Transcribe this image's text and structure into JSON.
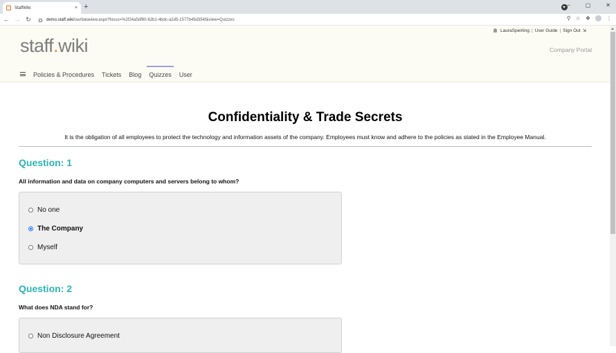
{
  "browser": {
    "tab_title": "StaffWiki",
    "tab_close": "×",
    "new_tab": "+",
    "window_controls": [
      "–",
      "▢",
      "✕"
    ],
    "url_host": "demo.staff.wiki",
    "url_path": "/sw/dataview.aspx?focus=%2f24a5df80-62b1-4bdc-a2d5-1577b45d354f&view=Quizzes"
  },
  "site": {
    "logo_main": "staff",
    "logo_dot": ".",
    "logo_suffix": "wiki",
    "portal_label": "Company Portal",
    "user_name": "LauraSpeirling",
    "user_guide": "User Guide",
    "sign_out": "Sign Out",
    "nav": [
      "Policies & Procedures",
      "Tickets",
      "Blog",
      "Quizzes",
      "User"
    ],
    "active_nav": "Quizzes"
  },
  "quiz": {
    "title": "Confidentiality & Trade Secrets",
    "intro": "It is the obligation of all employees to protect the technology and information assets of the company. Employees must know and adhere to the policies as stated in the Employee Manual.",
    "questions": [
      {
        "heading": "Question: 1",
        "text": "All information and data on company computers and servers belong to whom?",
        "options": [
          "No one",
          "The Company",
          "Myself"
        ],
        "selected": "The Company"
      },
      {
        "heading": "Question: 2",
        "text": "What does NDA stand for?",
        "options": [
          "Non Disclosure Agreement"
        ]
      }
    ]
  }
}
